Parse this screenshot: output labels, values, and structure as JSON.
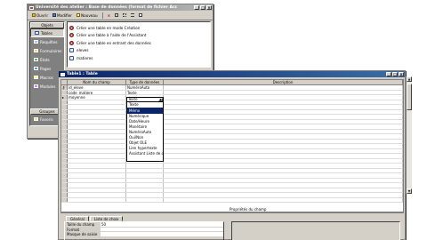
{
  "db_window": {
    "title": "Université des atelier : Base de données (format de fichier Acc",
    "toolbar": {
      "open": "Ouvrir",
      "modify": "Modifier",
      "new": "Nouveau"
    },
    "objects_header": "Objets",
    "objects": [
      "Tables",
      "Requêtes",
      "Formulaires",
      "États",
      "Pages",
      "Macros",
      "Modules"
    ],
    "groups_header": "Groupes",
    "favorites": "Favoris",
    "list": [
      {
        "label": "Créer une table en mode Création",
        "icon": "wizard-icon"
      },
      {
        "label": "Créer une table à l'aide de l'Assistant",
        "icon": "wizard-icon"
      },
      {
        "label": "Créer une table en entrant des données",
        "icon": "wizard-icon"
      },
      {
        "label": "eleves",
        "icon": "table-icon"
      },
      {
        "label": "matieres",
        "icon": "table-icon"
      }
    ]
  },
  "table_window": {
    "title": "Table1 : Table",
    "columns": [
      "Nom du champ",
      "Type de données",
      "Description"
    ],
    "rows": [
      {
        "field": "id_eleve",
        "type": "NuméroAuto",
        "key": true
      },
      {
        "field": "code_matiere",
        "type": "Texte",
        "key": false
      },
      {
        "field": "moyenne",
        "type": "Texte",
        "key": false
      }
    ],
    "combo_value": "Texte",
    "dropdown_options": [
      "Texte",
      "Mémo",
      "Numérique",
      "Date/Heure",
      "Monétaire",
      "NuméroAuto",
      "Oui/Non",
      "Objet OLE",
      "Lien hypertexte",
      "Assistant Liste de ch..."
    ],
    "dropdown_selected": 0,
    "properties_title": "Propriétés du champ",
    "tabs": [
      "Général",
      "Liste de choix"
    ],
    "props": [
      {
        "label": "Taille du champ",
        "value": "50"
      },
      {
        "label": "Format",
        "value": ""
      },
      {
        "label": "Masque de saisie",
        "value": ""
      }
    ]
  },
  "colors": {
    "active_title": "#0a246a",
    "inactive_title": "#7a7a7a",
    "window_bg": "#d4d0c8",
    "highlight": "#0a246a"
  }
}
